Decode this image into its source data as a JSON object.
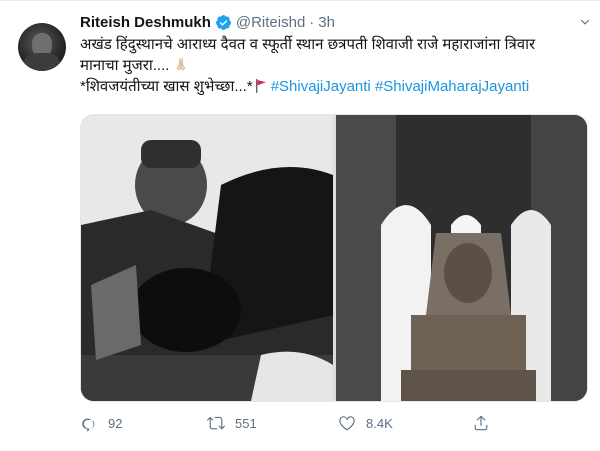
{
  "tweet": {
    "author_name": "Riteish Deshmukh",
    "handle": "@Riteishd",
    "separator": "·",
    "time": "3h",
    "text_line1": "अखंड हिंदुस्थानचे आराध्य दैवत व स्फूर्ती स्थान छत्रपती शिवाजी राजे महाराजांना त्रिवार",
    "text_line2": "मानाचा मुजरा....",
    "text_line3": "*शिवजयंतीच्या खास  शुभेच्छा...*",
    "hashtag1": "#ShivajiJayanti",
    "hashtag2": "#ShivajiMaharajJayanti"
  },
  "actions": {
    "reply_count": "92",
    "retweet_count": "551",
    "like_count": "8.4K"
  },
  "icons": {
    "verified": "verified-badge-icon",
    "reply": "reply-icon",
    "retweet": "retweet-icon",
    "like": "heart-icon",
    "share": "share-icon",
    "more": "chevron-down-icon",
    "emoji1": "folded-hands-icon",
    "emoji2": "red-flag-icon"
  },
  "colors": {
    "link": "#1b95e0",
    "muted": "#5b7083",
    "verified": "#1da1f2",
    "flag": "#e0245e"
  }
}
